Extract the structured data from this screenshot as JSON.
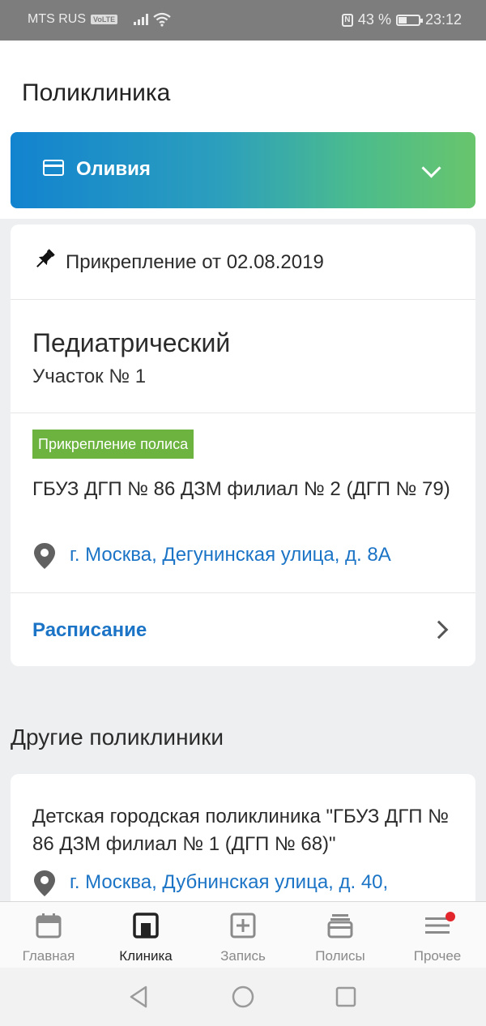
{
  "status_bar": {
    "carrier": "MTS RUS",
    "volte": "VoLTE",
    "nfc": "N",
    "battery": "43 %",
    "battery_level": 0.43,
    "time": "23:12"
  },
  "header": {
    "title": "Поликлиника",
    "profile_name": "Оливия"
  },
  "attachment": {
    "text": "Прикрепление от 02.08.2019",
    "district_title": "Педиатрический",
    "district_sub": "Участок № 1",
    "badge": "Прикрепление полиса",
    "clinic_name": "ГБУЗ ДГП № 86 ДЗМ филиал № 2 (ДГП № 79)",
    "address": "г. Москва, Дегунинская улица, д. 8А",
    "schedule_label": "Расписание"
  },
  "other_clinics": {
    "section_title": "Другие поликлиники",
    "items": [
      {
        "name": "Детская городская поликлиника \"ГБУЗ ДГП № 86 ДЗМ филиал № 1 (ДГП № 68)\"",
        "address": "г. Москва, Дубнинская улица, д. 40,"
      }
    ]
  },
  "bottom_nav": {
    "items": [
      {
        "label": "Главная",
        "icon": "calendar-icon"
      },
      {
        "label": "Клиника",
        "icon": "clinic-icon",
        "active": true
      },
      {
        "label": "Запись",
        "icon": "plus-square-icon"
      },
      {
        "label": "Полисы",
        "icon": "wallet-icon"
      },
      {
        "label": "Прочее",
        "icon": "menu-icon",
        "notification": true
      }
    ]
  },
  "colors": {
    "accent_blue": "#1c74c6",
    "badge_green": "#6cb33f",
    "gradient_start": "#1283cf",
    "gradient_end": "#68c56c",
    "notification_red": "#e3262b"
  }
}
